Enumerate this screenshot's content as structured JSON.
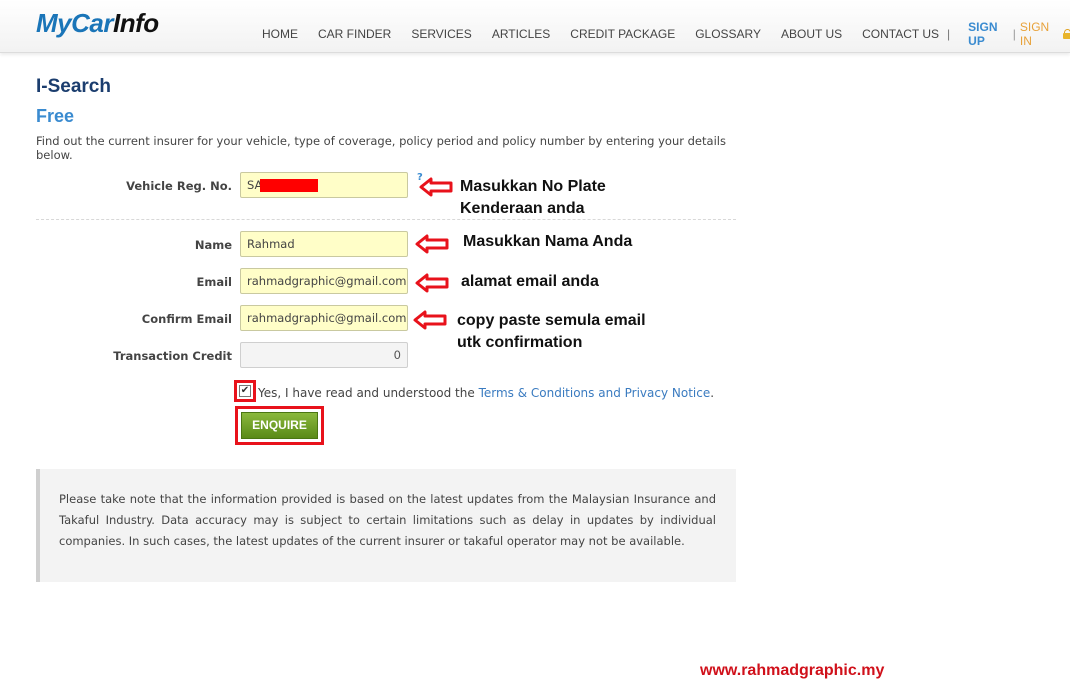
{
  "header": {
    "logo_part1": "MyCar",
    "logo_part2": "Info",
    "nav": [
      "HOME",
      "CAR FINDER",
      "SERVICES",
      "ARTICLES",
      "CREDIT PACKAGE",
      "GLOSSARY",
      "ABOUT US",
      "CONTACT US"
    ],
    "separator": "|",
    "sign_up": "SIGN UP",
    "auth_separator": "|",
    "sign_in": "SIGN IN"
  },
  "page": {
    "title": "I-Search",
    "subtitle": "Free",
    "intro": "Find out the current insurer for your vehicle, type of coverage, policy period and policy number by entering your details below."
  },
  "form": {
    "vehicle_label": "Vehicle Reg. No.",
    "vehicle_value": "SA",
    "help": "?",
    "name_label": "Name",
    "name_value": "Rahmad",
    "email_label": "Email",
    "email_value": "rahmadgraphic@gmail.com",
    "confirm_label": "Confirm Email",
    "confirm_value": "rahmadgraphic@gmail.com",
    "credit_label": "Transaction Credit",
    "credit_value": "0",
    "checkbox_mark": "✔",
    "agree_text": "Yes, I have read and understood the ",
    "agree_link": "Terms & Conditions and Privacy Notice",
    "agree_end": ".",
    "enquire_label": "ENQUIRE"
  },
  "annotations": {
    "vehicle_line1": "Masukkan No Plate",
    "vehicle_line2": "Kenderaan anda",
    "name": "Masukkan Nama Anda",
    "email": "alamat email anda",
    "confirm_line1": "copy paste semula email",
    "confirm_line2": "utk confirmation"
  },
  "notice": "Please take note that the information provided is based on the latest updates from the Malaysian Insurance and Takaful Industry. Data accuracy may is subject to certain limitations such as delay in updates by individual companies. In such cases, the latest updates of the current insurer or takaful operator may not be available.",
  "watermark": "www.rahmadgraphic.my",
  "colors": {
    "accent_blue": "#3a8bd0",
    "title_navy": "#1b3d6e",
    "annotation_red": "#e8121b",
    "button_green": "#6f9e26",
    "input_yellow": "#fffec8"
  }
}
